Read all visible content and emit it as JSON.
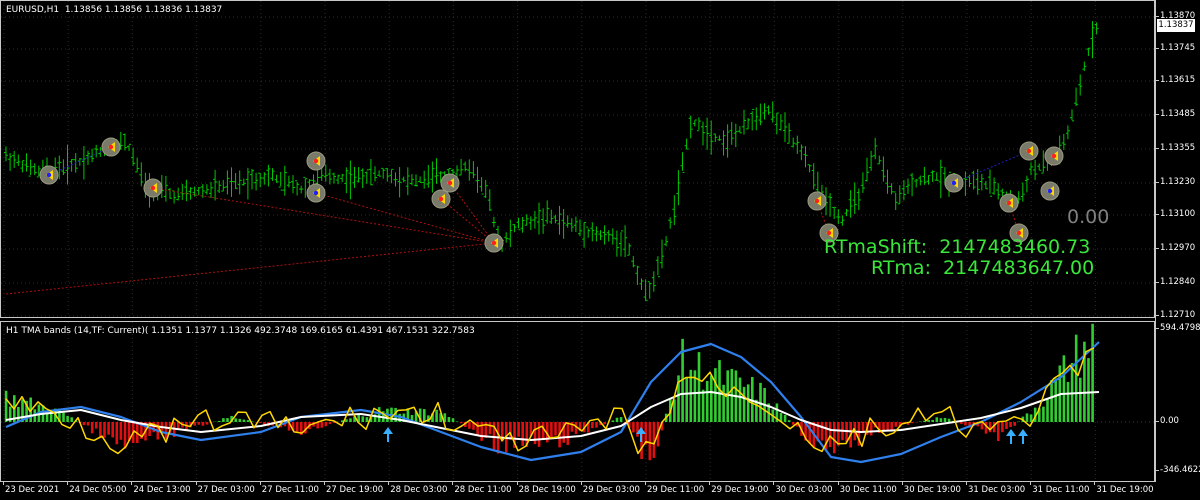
{
  "symbol_header": "EURUSD,H1  1.13856 1.13856 1.13836 1.13837",
  "indicator_header": "H1 TMA bands (14,TF: Current)( 1.1351 1.1377 1.1326 492.3748 169.6165 61.4391 467.1531 322.7583",
  "current_price": "1.13837",
  "price_axis": [
    "1.13870",
    "1.13745",
    "1.13615",
    "1.13485",
    "1.13355",
    "1.13230",
    "1.13100",
    "1.12970",
    "1.12840",
    "1.12710"
  ],
  "indicator_axis": [
    "594.4798",
    "0.00",
    "-346.4622"
  ],
  "time_axis": [
    "23 Dec 2021",
    "24 Dec 05:00",
    "24 Dec 13:00",
    "27 Dec 03:00",
    "27 Dec 11:00",
    "27 Dec 19:00",
    "28 Dec 03:00",
    "28 Dec 11:00",
    "28 Dec 19:00",
    "29 Dec 03:00",
    "29 Dec 11:00",
    "29 Dec 19:00",
    "30 Dec 03:00",
    "30 Dec 11:00",
    "30 Dec 19:00",
    "31 Dec 03:00",
    "31 Dec 11:00",
    "31 Dec 19:00"
  ],
  "rtma": {
    "shift_text": "RTmaShift:  2147483460.73",
    "value_text": "RTma:  2147483647.00",
    "zero_text": "0.00"
  },
  "colors": {
    "background": "#000000",
    "bar_color": "#00c800",
    "grid": "#2a2a2a",
    "rtma_text": "#39e639",
    "tma_blue": "#2f80ed",
    "tma_white": "#ffffff",
    "tma_yellow": "#ffd700",
    "hist_up": "#32cd32",
    "hist_down": "#e01010"
  }
}
